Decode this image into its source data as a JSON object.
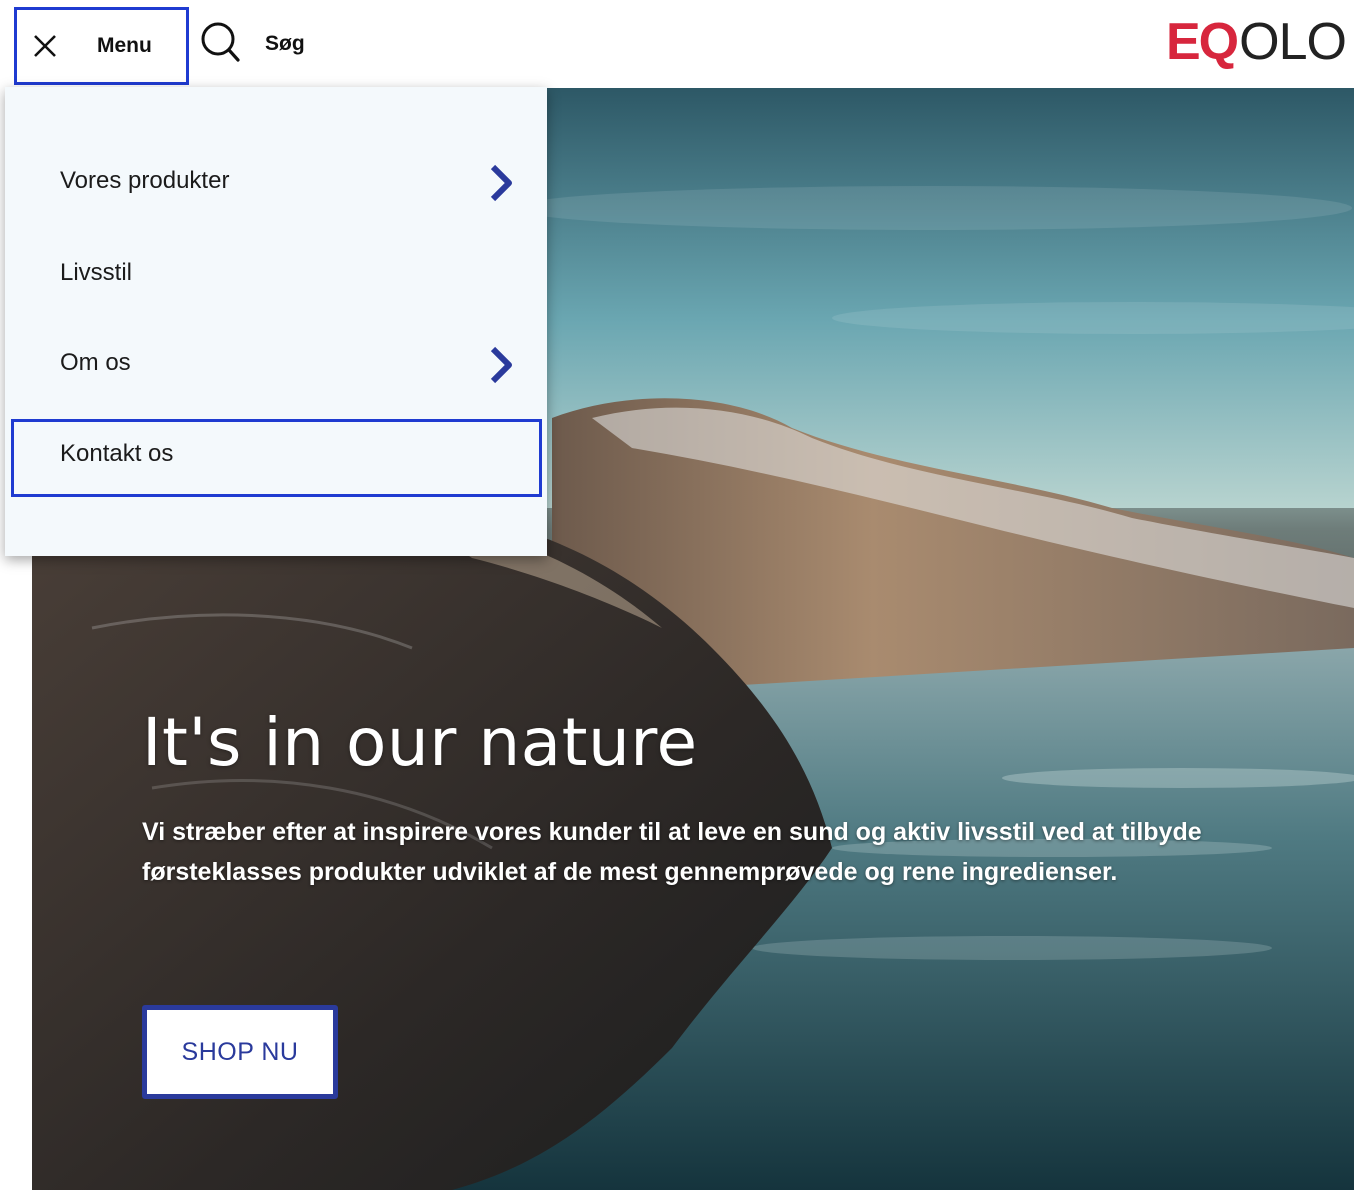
{
  "header": {
    "menu_label": "Menu",
    "search_label": "Søg",
    "logo_brand": "EQ",
    "logo_rest": "OLO",
    "accent_color": "#1f3bd1",
    "brand_color": "#d7263d"
  },
  "menu": {
    "items": [
      {
        "label": "Vores produkter",
        "has_submenu": true
      },
      {
        "label": "Livsstil",
        "has_submenu": false
      },
      {
        "label": "Om os",
        "has_submenu": true
      },
      {
        "label": "Kontakt os",
        "has_submenu": false,
        "focused": true
      }
    ]
  },
  "hero": {
    "title": "It's in our nature",
    "text": "Vi stræber efter at inspirere vores kunder til at leve en sund og aktiv livsstil ved at tilbyde førsteklasses produkter udviklet af de mest gennemprøvede og rene ingredienser.",
    "cta_label": "SHOP NU",
    "cta_color": "#2a3a9c"
  }
}
